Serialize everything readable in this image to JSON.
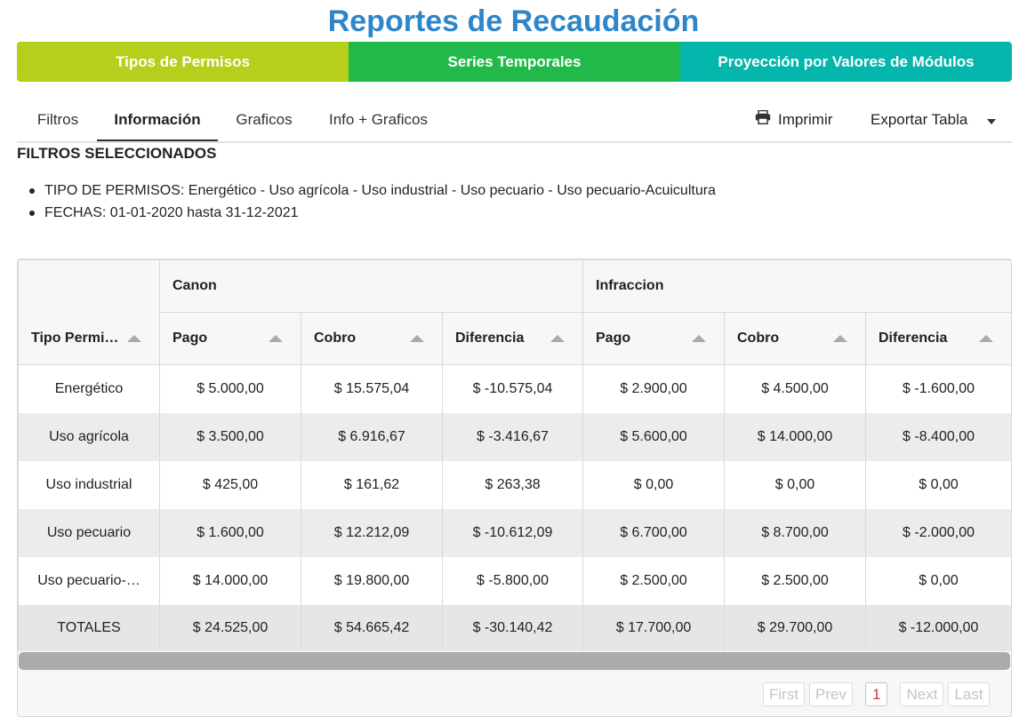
{
  "title": "Reportes de Recaudación",
  "main_tabs": [
    {
      "label": "Tipos de Permisos",
      "color": "#b5cf1c"
    },
    {
      "label": "Series Temporales",
      "color": "#22b94b"
    },
    {
      "label": "Proyección por Valores de Módulos",
      "color": "#05b6ac"
    }
  ],
  "subtabs": {
    "filtros": "Filtros",
    "informacion": "Información",
    "graficos": "Graficos",
    "info_graficos": "Info + Graficos",
    "active": "Información"
  },
  "toolbar": {
    "print_label": "Imprimir",
    "print_icon": "printer-icon",
    "export_label": "Exportar Tabla",
    "export_icon": "caret-down-icon"
  },
  "filters": {
    "title": "FILTROS SELECCIONADOS",
    "items": [
      "TIPO DE PERMISOS: Energético - Uso agrícola - Uso industrial - Uso pecuario - Uso pecuario-Acuicultura",
      "FECHAS: 01-01-2020 hasta 31-12-2021"
    ]
  },
  "table": {
    "groups": [
      "Canon",
      "Infraccion"
    ],
    "columns": [
      "Tipo Permi…",
      "Pago",
      "Cobro",
      "Diferencia",
      "Pago",
      "Cobro",
      "Diferencia"
    ],
    "rows": [
      [
        "Energético",
        "$ 5.000,00",
        "$ 15.575,04",
        "$ -10.575,04",
        "$ 2.900,00",
        "$ 4.500,00",
        "$ -1.600,00"
      ],
      [
        "Uso agrícola",
        "$ 3.500,00",
        "$ 6.916,67",
        "$ -3.416,67",
        "$ 5.600,00",
        "$ 14.000,00",
        "$ -8.400,00"
      ],
      [
        "Uso industrial",
        "$ 425,00",
        "$ 161,62",
        "$ 263,38",
        "$ 0,00",
        "$ 0,00",
        "$ 0,00"
      ],
      [
        "Uso pecuario",
        "$ 1.600,00",
        "$ 12.212,09",
        "$ -10.612,09",
        "$ 6.700,00",
        "$ 8.700,00",
        "$ -2.000,00"
      ],
      [
        "Uso pecuario-…",
        "$ 14.000,00",
        "$ 19.800,00",
        "$ -5.800,00",
        "$ 2.500,00",
        "$ 2.500,00",
        "$ 0,00"
      ],
      [
        "TOTALES",
        "$ 24.525,00",
        "$ 54.665,42",
        "$ -30.140,42",
        "$ 17.700,00",
        "$ 29.700,00",
        "$ -12.000,00"
      ]
    ]
  },
  "pagination": {
    "first": "First",
    "prev": "Prev",
    "current": "1",
    "next": "Next",
    "last": "Last"
  }
}
